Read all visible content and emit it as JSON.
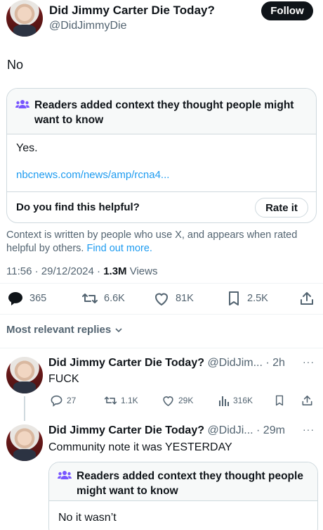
{
  "post": {
    "author_name": "Did Jimmy Carter Die Today?",
    "handle": "@DidJimmyDie",
    "follow_label": "Follow",
    "text": "No",
    "note": {
      "header": "Readers added context they thought people might want to know",
      "body": "Yes.",
      "link": "nbcnews.com/news/amp/rcna4...",
      "question": "Do you find this helpful?",
      "rate_label": "Rate it"
    },
    "context_text": "Context is written by people who use X, and appears when rated helpful by others.",
    "find_out_more": "Find out more.",
    "time": "11:56",
    "date": "29/12/2024",
    "views_count": "1.3M",
    "views_label": "Views",
    "metrics": {
      "replies": "365",
      "reposts": "6.6K",
      "likes": "81K",
      "bookmarks": "2.5K"
    }
  },
  "replies_filter": "Most relevant replies",
  "replies": [
    {
      "author_name": "Did Jimmy Carter Die Today?",
      "handle_time": "@DidJim... · 2h",
      "text": "FUCK",
      "metrics": {
        "replies": "27",
        "reposts": "1.1K",
        "likes": "29K",
        "views": "316K"
      }
    },
    {
      "author_name": "Did Jimmy Carter Die Today?",
      "handle_time": "@DidJi... · 29m",
      "text": "Community note it was YESTERDAY",
      "note": {
        "header": "Readers added context they thought people might want to know",
        "body": "No it wasn’t"
      }
    }
  ],
  "colors": {
    "accent": "#1d9bf0",
    "text": "#0f1419",
    "muted": "#536471",
    "note_icon": "#7856ff"
  }
}
